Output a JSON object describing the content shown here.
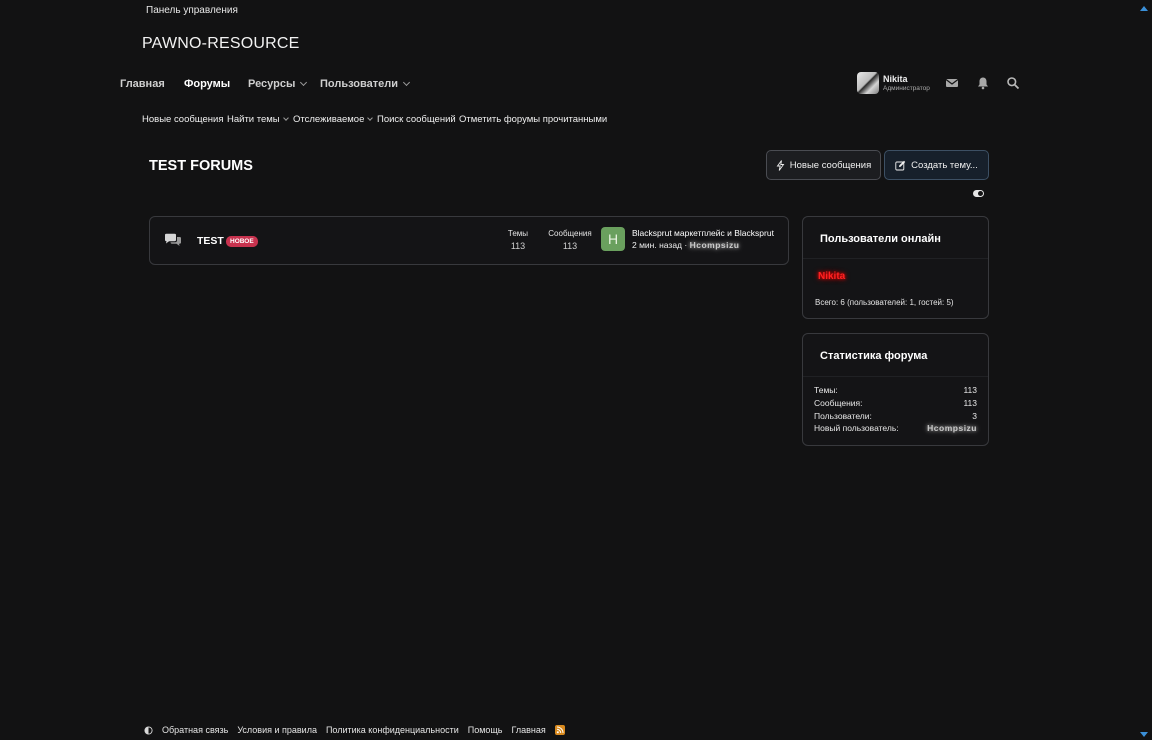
{
  "header": {
    "admin_link": "Панель управления",
    "site_title": "PAWNO-RESOURCE"
  },
  "nav": {
    "items": [
      {
        "label": "Главная"
      },
      {
        "label": "Форумы"
      },
      {
        "label": "Ресурсы"
      },
      {
        "label": "Пользователи"
      }
    ],
    "active": "Форумы"
  },
  "subnav": {
    "items": [
      {
        "label": "Новые сообщения"
      },
      {
        "label": "Найти темы"
      },
      {
        "label": "Отслеживаемое"
      },
      {
        "label": "Поиск сообщений"
      },
      {
        "label": "Отметить форумы прочитанными"
      }
    ]
  },
  "user": {
    "name": "Nikita",
    "role": "Администратор"
  },
  "icons": {
    "inbox": "envelope-icon",
    "alerts": "bell-icon",
    "search": "search-icon"
  },
  "page": {
    "title": "TEST FORUMS",
    "new_posts_button": "Новые сообщения",
    "create_thread_button": "Создать тему..."
  },
  "forum": {
    "name": "TEST",
    "badge": "НОВОЕ",
    "threads_label": "Темы",
    "threads_value": "113",
    "messages_label": "Сообщения",
    "messages_value": "113",
    "last_avatar_letter": "H",
    "last_post_title": "Blacksprut маркетплейс и Blacksprut",
    "last_post_time": "2 мин. назад",
    "last_post_sep": "·",
    "last_post_user": "Hcompsizu"
  },
  "online": {
    "title": "Пользователи онлайн",
    "user": "Nikita",
    "total": "Всего: 6 (пользователей: 1, гостей: 5)"
  },
  "stats": {
    "title": "Статистика форума",
    "rows": [
      {
        "label": "Темы:",
        "value": "113"
      },
      {
        "label": "Сообщения:",
        "value": "113"
      },
      {
        "label": "Пользователи:",
        "value": "3"
      },
      {
        "label": "Новый пользователь:",
        "value": "Hcompsizu"
      }
    ]
  },
  "footer": {
    "links": [
      {
        "label": "Обратная связь"
      },
      {
        "label": "Условия и правила"
      },
      {
        "label": "Политика конфиденциальности"
      },
      {
        "label": "Помощь"
      },
      {
        "label": "Главная"
      }
    ]
  },
  "colors": {
    "background": "#121213",
    "badge": "#c8334f",
    "online_user": "#ff2222",
    "accent": "#3a8fd8"
  }
}
